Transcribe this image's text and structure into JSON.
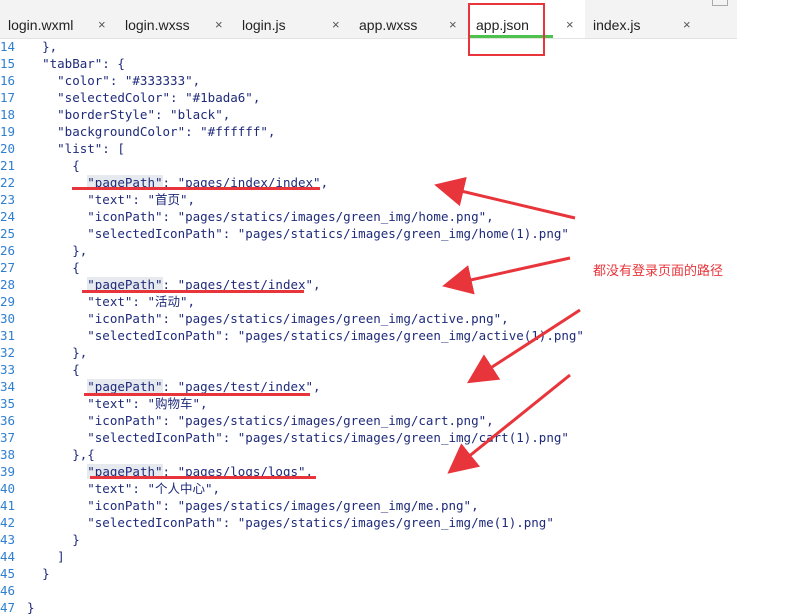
{
  "tabs": [
    {
      "label": "login.wxml",
      "close": "×"
    },
    {
      "label": "login.wxss",
      "close": "×"
    },
    {
      "label": "login.js",
      "close": "×"
    },
    {
      "label": "app.wxss",
      "close": "×"
    },
    {
      "label": "app.json",
      "close": "×",
      "active": true
    },
    {
      "label": "index.js",
      "close": "×"
    }
  ],
  "code": {
    "lines": [
      {
        "num": "14",
        "text": "    },"
      },
      {
        "num": "15",
        "text": "    \"tabBar\": {"
      },
      {
        "num": "16",
        "text": "      \"color\": \"#333333\","
      },
      {
        "num": "17",
        "text": "      \"selectedColor\": \"#1bada6\","
      },
      {
        "num": "18",
        "text": "      \"borderStyle\": \"black\","
      },
      {
        "num": "19",
        "text": "      \"backgroundColor\": \"#ffffff\","
      },
      {
        "num": "20",
        "text": "      \"list\": ["
      },
      {
        "num": "21",
        "text": "        {"
      },
      {
        "num": "22",
        "text": "          \"pagePath\": \"pages/index/index\","
      },
      {
        "num": "23",
        "text": "          \"text\": \"首页\","
      },
      {
        "num": "24",
        "text": "          \"iconPath\": \"pages/statics/images/green_img/home.png\","
      },
      {
        "num": "25",
        "text": "          \"selectedIconPath\": \"pages/statics/images/green_img/home(1).png\""
      },
      {
        "num": "26",
        "text": "        },"
      },
      {
        "num": "27",
        "text": "        {"
      },
      {
        "num": "28",
        "text": "          \"pagePath\": \"pages/test/index\","
      },
      {
        "num": "29",
        "text": "          \"text\": \"活动\","
      },
      {
        "num": "30",
        "text": "          \"iconPath\": \"pages/statics/images/green_img/active.png\","
      },
      {
        "num": "31",
        "text": "          \"selectedIconPath\": \"pages/statics/images/green_img/active(1).png\""
      },
      {
        "num": "32",
        "text": "        },"
      },
      {
        "num": "33",
        "text": "        {"
      },
      {
        "num": "34",
        "text": "          \"pagePath\": \"pages/test/index\","
      },
      {
        "num": "35",
        "text": "          \"text\": \"购物车\","
      },
      {
        "num": "36",
        "text": "          \"iconPath\": \"pages/statics/images/green_img/cart.png\","
      },
      {
        "num": "37",
        "text": "          \"selectedIconPath\": \"pages/statics/images/green_img/cart(1).png\""
      },
      {
        "num": "38",
        "text": "        },{"
      },
      {
        "num": "39",
        "text": "          \"pagePath\": \"pages/logs/logs\","
      },
      {
        "num": "40",
        "text": "          \"text\": \"个人中心\","
      },
      {
        "num": "41",
        "text": "          \"iconPath\": \"pages/statics/images/green_img/me.png\","
      },
      {
        "num": "42",
        "text": "          \"selectedIconPath\": \"pages/statics/images/green_img/me(1).png\""
      },
      {
        "num": "43",
        "text": "        }"
      },
      {
        "num": "44",
        "text": "      ]"
      },
      {
        "num": "45",
        "text": "    }"
      },
      {
        "num": "46",
        "text": ""
      },
      {
        "num": "47",
        "text": "  }"
      }
    ]
  },
  "annotation": {
    "text": "都没有登录页面的路径",
    "color": "#e8353b"
  },
  "colors": {
    "line_number": "#2f7fd1",
    "code_text": "#1f2b7a",
    "active_tab_underline": "#4ec14e",
    "keyword_highlight": "#e6e9ee"
  }
}
